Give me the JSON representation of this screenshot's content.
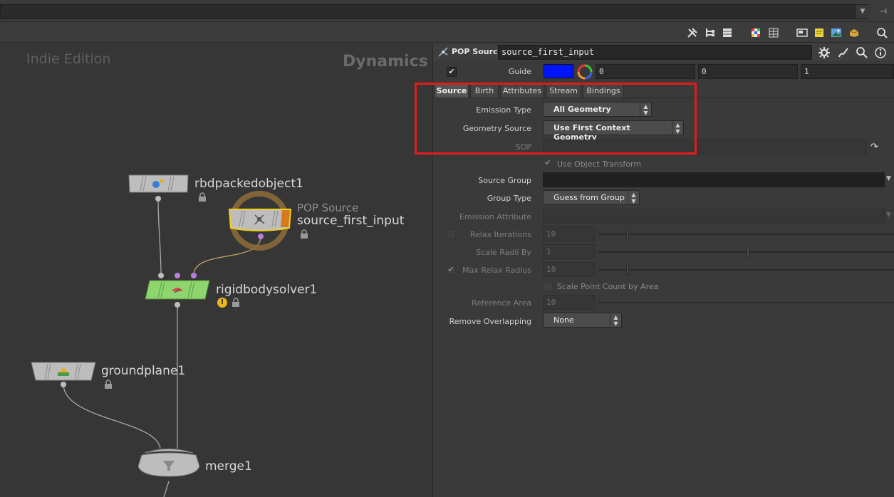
{
  "toolbar": {
    "pin_glyph": "⊣",
    "icons": [
      "wrench-icon",
      "tree-icon",
      "list-icon",
      "color-grid-icon",
      "spreadsheet-icon",
      "panel-icon",
      "sticky-note-icon",
      "image-icon",
      "box-icon",
      "search-icon"
    ]
  },
  "network": {
    "edition_label": "Indie Edition",
    "context_label": "Dynamics",
    "nodes": {
      "rbd": {
        "label": "rbdpackedobject1"
      },
      "pop": {
        "type_label": "POP Source",
        "label": "source_first_input"
      },
      "solver": {
        "label": "rigidbodysolver1",
        "warning": "!"
      },
      "ground": {
        "label": "groundplane1"
      },
      "merge": {
        "label": "merge1"
      }
    }
  },
  "params": {
    "op_type": "POP Source",
    "op_name": "source_first_input",
    "guide": {
      "label": "Guide",
      "color": "#0014ff",
      "values": [
        "0",
        "0",
        "1"
      ]
    },
    "tabs": [
      "Source",
      "Birth",
      "Attributes",
      "Stream",
      "Bindings"
    ],
    "active_tab": "Source",
    "emission_type": {
      "label": "Emission Type",
      "value": "All Geometry"
    },
    "geometry_source": {
      "label": "Geometry Source",
      "value": "Use First Context Geometry"
    },
    "sop": {
      "label": "SOP",
      "value": ""
    },
    "use_object_transform": {
      "label": "Use Object Transform"
    },
    "source_group": {
      "label": "Source Group",
      "value": ""
    },
    "group_type": {
      "label": "Group Type",
      "value": "Guess from Group"
    },
    "emission_attribute": {
      "label": "Emission Attribute",
      "value": ""
    },
    "relax_iterations": {
      "label": "Relax Iterations",
      "value": "10",
      "slider": 0.07
    },
    "scale_radii_by": {
      "label": "Scale Radii By",
      "value": "1",
      "slider": 0.5
    },
    "max_relax_radius": {
      "label": "Max Relax Radius",
      "value": "10",
      "slider": 0.07
    },
    "scale_point_count": {
      "label": "Scale Point Count by Area"
    },
    "reference_area": {
      "label": "Reference Area",
      "value": "10"
    },
    "remove_overlapping": {
      "label": "Remove Overlapping",
      "value": "None"
    },
    "accent_color": "#e21b1b"
  }
}
